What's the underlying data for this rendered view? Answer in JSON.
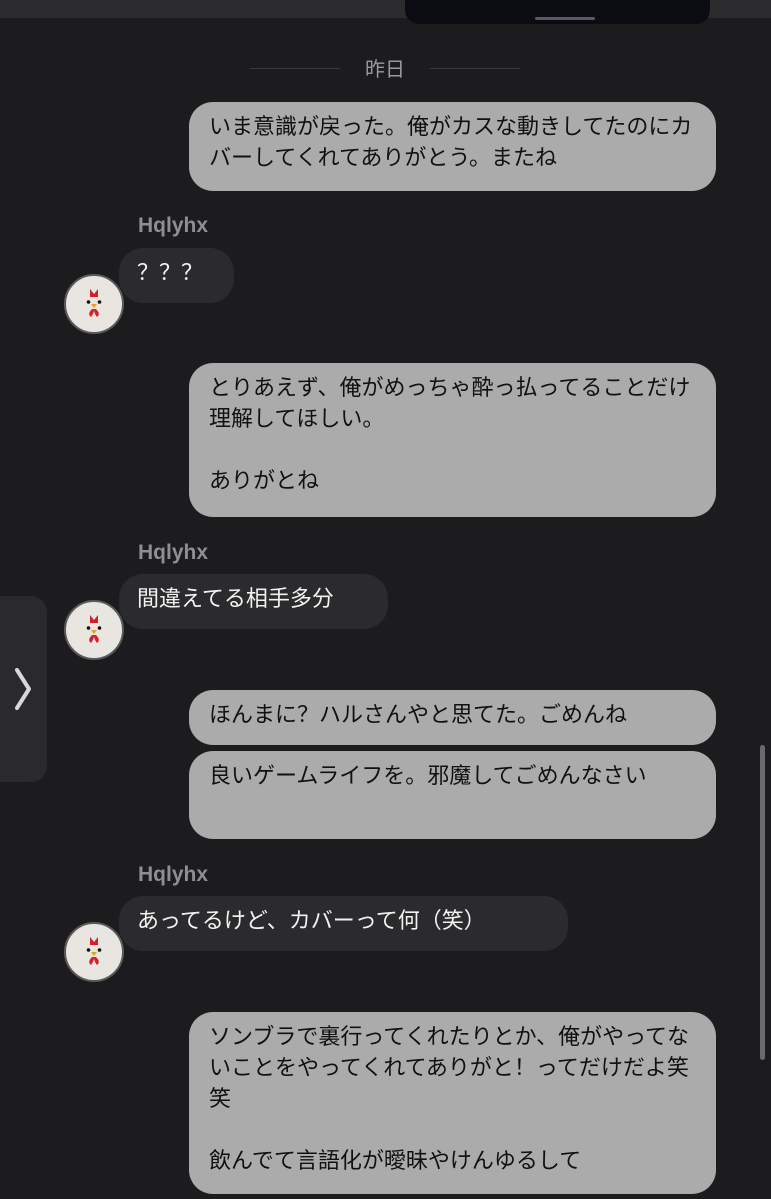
{
  "date_separator": "昨日",
  "messages": [
    {
      "text": "いま意識が戻った。俺がカスな動きしてたのにカバーしてくれてありがとう。またね"
    },
    {
      "sender": "Hqlyhx",
      "text": "？？？"
    },
    {
      "text": "とりあえず、俺がめっちゃ酔っ払ってることだけ理解してほしい。\n\nありがとね"
    },
    {
      "sender": "Hqlyhx",
      "text": "間違えてる相手多分"
    },
    {
      "text": "ほんまに？ハルさんやと思てた。ごめんね"
    },
    {
      "text": "良いゲームライフを。邪魔してごめんなさい"
    },
    {
      "sender": "Hqlyhx",
      "text": "あってるけど、カバーって何（笑）"
    },
    {
      "text": "ソンブラで裏行ってくれたりとか、俺がやってないことをやってくれてありがと！ってだけだよ笑笑\n\n飲んでて言語化が曖昧やけんゆるして"
    }
  ],
  "avatar_icon": "rooster-icon",
  "side_panel_icon": "chevron-right-icon",
  "colors": {
    "background": "#1c1c1e",
    "outgoing_bubble": "#ababab",
    "incoming_bubble": "#2b2b2d",
    "sender_name": "#8e8e93"
  }
}
